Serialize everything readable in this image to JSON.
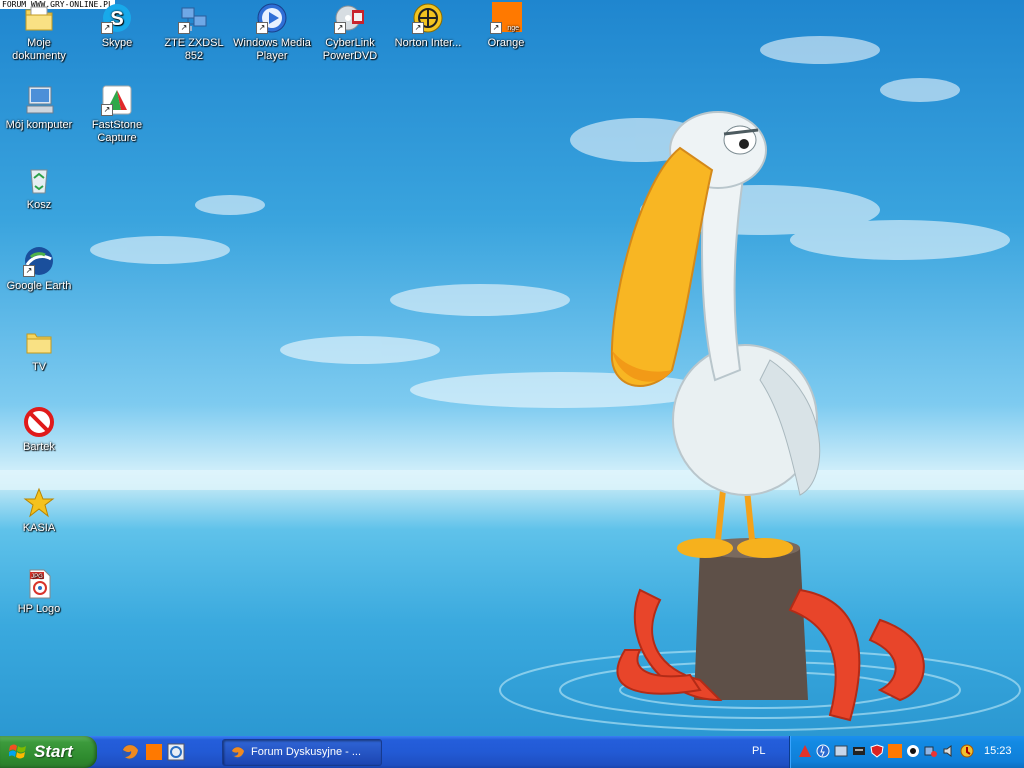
{
  "watermark": "FORUM WWW.GRY-ONLINE.PL",
  "desktop": {
    "icons": [
      {
        "label": "Moje dokumenty",
        "icon": "folder-documents-icon"
      },
      {
        "label": "Skype",
        "icon": "skype-icon"
      },
      {
        "label": "ZTE ZXDSL 852",
        "icon": "network-modem-icon"
      },
      {
        "label": "Windows Media Player",
        "icon": "media-player-icon"
      },
      {
        "label": "CyberLink PowerDVD",
        "icon": "dvd-player-icon"
      },
      {
        "label": "Norton Inter...",
        "icon": "norton-globe-icon"
      },
      {
        "label": "Orange",
        "icon": "orange-icon"
      },
      {
        "label": "Mój komputer",
        "icon": "my-computer-icon"
      },
      {
        "label": "FastStone Capture",
        "icon": "faststone-capture-icon"
      },
      {
        "label": "Kosz",
        "icon": "recycle-bin-icon"
      },
      {
        "label": "Google Earth",
        "icon": "google-earth-icon"
      },
      {
        "label": "TV",
        "icon": "folder-icon"
      },
      {
        "label": "Bartek",
        "icon": "no-entry-icon"
      },
      {
        "label": "KASIA",
        "icon": "star-icon"
      },
      {
        "label": "HP Logo",
        "icon": "jpg-file-icon"
      }
    ]
  },
  "taskbar": {
    "start_label": "Start",
    "quick_launch": [
      "firefox-icon",
      "orange-icon",
      "ie-settings-icon"
    ],
    "quick_launch_more": "»",
    "task_button": "Forum Dyskusyjne - ...",
    "language": "PL",
    "tray_icons": [
      "network-icon",
      "antivirus-icon",
      "security-icon",
      "sound-card-icon",
      "shield-icon",
      "orange-icon",
      "speaker-icon",
      "network-warning-icon",
      "speaker-volume-icon",
      "update-icon"
    ],
    "clock": "15:23"
  },
  "colors": {
    "taskbar_blue": "#245edb",
    "start_green": "#3c9a3c",
    "tray_blue": "#138ae3"
  }
}
